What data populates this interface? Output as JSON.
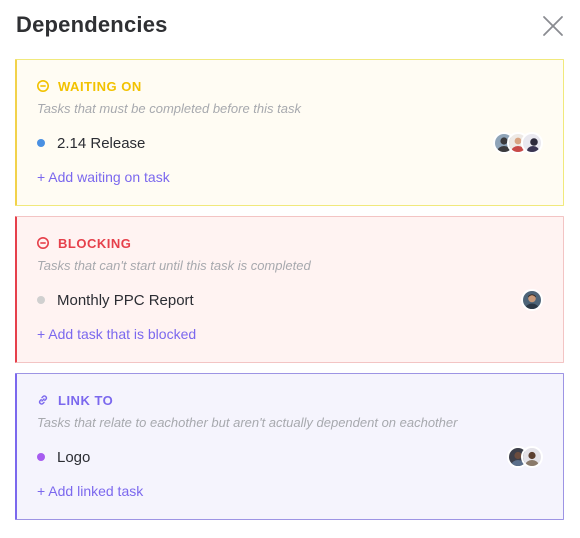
{
  "dialog": {
    "title": "Dependencies"
  },
  "sections": {
    "waiting": {
      "label": "WAITING ON",
      "description": "Tasks that must be completed before this task",
      "task": {
        "name": "2.14 Release",
        "dot_color": "#4a90e2"
      },
      "add_label": "+ Add waiting on task",
      "color": "#f2c200",
      "bg": "#fffcf3",
      "border": "#f1e97c"
    },
    "blocking": {
      "label": "BLOCKING",
      "description": "Tasks that can't start until this task is completed",
      "task": {
        "name": "Monthly PPC Report",
        "dot_color": "#d0d0d0"
      },
      "add_label": "+ Add task that is blocked",
      "color": "#e6404b",
      "bg": "#fff3f2",
      "border": "#f3c4c4"
    },
    "link": {
      "label": "LINK TO",
      "description": "Tasks that relate to eachother but aren't actually dependent on eachother",
      "task": {
        "name": "Logo",
        "dot_color": "#a75cf0"
      },
      "add_label": "+ Add linked task",
      "color": "#7b68ee",
      "bg": "#f5f4fd",
      "border": "#9d94e4"
    }
  },
  "icons": {
    "close": "close-icon",
    "waiting": "minus-circle-icon",
    "blocking": "minus-circle-icon",
    "link": "link-icon"
  }
}
